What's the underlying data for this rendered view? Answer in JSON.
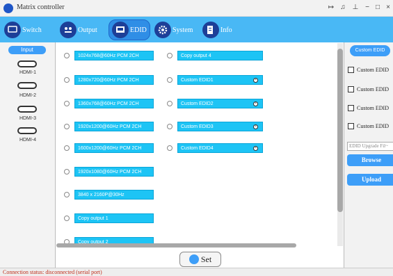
{
  "window": {
    "title": "Matrix controller",
    "controls": [
      "↦",
      "♫",
      "⊥",
      "−",
      "□",
      "×"
    ]
  },
  "tabs": [
    {
      "label": "Switch",
      "icon": "switch-icon"
    },
    {
      "label": "Output",
      "icon": "output-icon"
    },
    {
      "label": "EDID",
      "icon": "edid-icon",
      "active": true
    },
    {
      "label": "System",
      "icon": "gear-icon"
    },
    {
      "label": "Info",
      "icon": "info-icon"
    }
  ],
  "left_panel": {
    "header": "Input",
    "inputs": [
      "HDMI-1",
      "HDMI-2",
      "HDMI-3",
      "HDMI-4"
    ]
  },
  "edid_options": {
    "col1": [
      "1024x768@60Hz PCM 2CH",
      "1280x720@60Hz PCM 2CH",
      "1360x768@60Hz PCM 2CH",
      "1920x1200@60Hz PCM 2CH",
      "1600x1200@60Hz PCM 2CH",
      "1920x1080@60Hz PCM 2CH",
      "3840 x 2160P@30Hz",
      "Copy output 1",
      "Copy output 2"
    ],
    "col2": [
      "Copy output 4",
      "Custom EDID1",
      "Custom EDID2",
      "Custom EDID3",
      "Custom EDID4"
    ]
  },
  "set_button": "Set",
  "right_panel": {
    "header_button": "Custom EDID",
    "checkboxes": [
      "Custom EDID",
      "Custom EDID",
      "Custom EDID",
      "Custom EDID"
    ],
    "upgrade_placeholder": "EDID Upgrade Fil~",
    "browse": "Browse",
    "upload": "Upload"
  },
  "status": "Connection status: disconnected (serial port)",
  "colors": {
    "toolbar": "#49b8f5",
    "pill": "#1dc4f5",
    "accent": "#3d9ef8",
    "status": "#c0301c"
  }
}
